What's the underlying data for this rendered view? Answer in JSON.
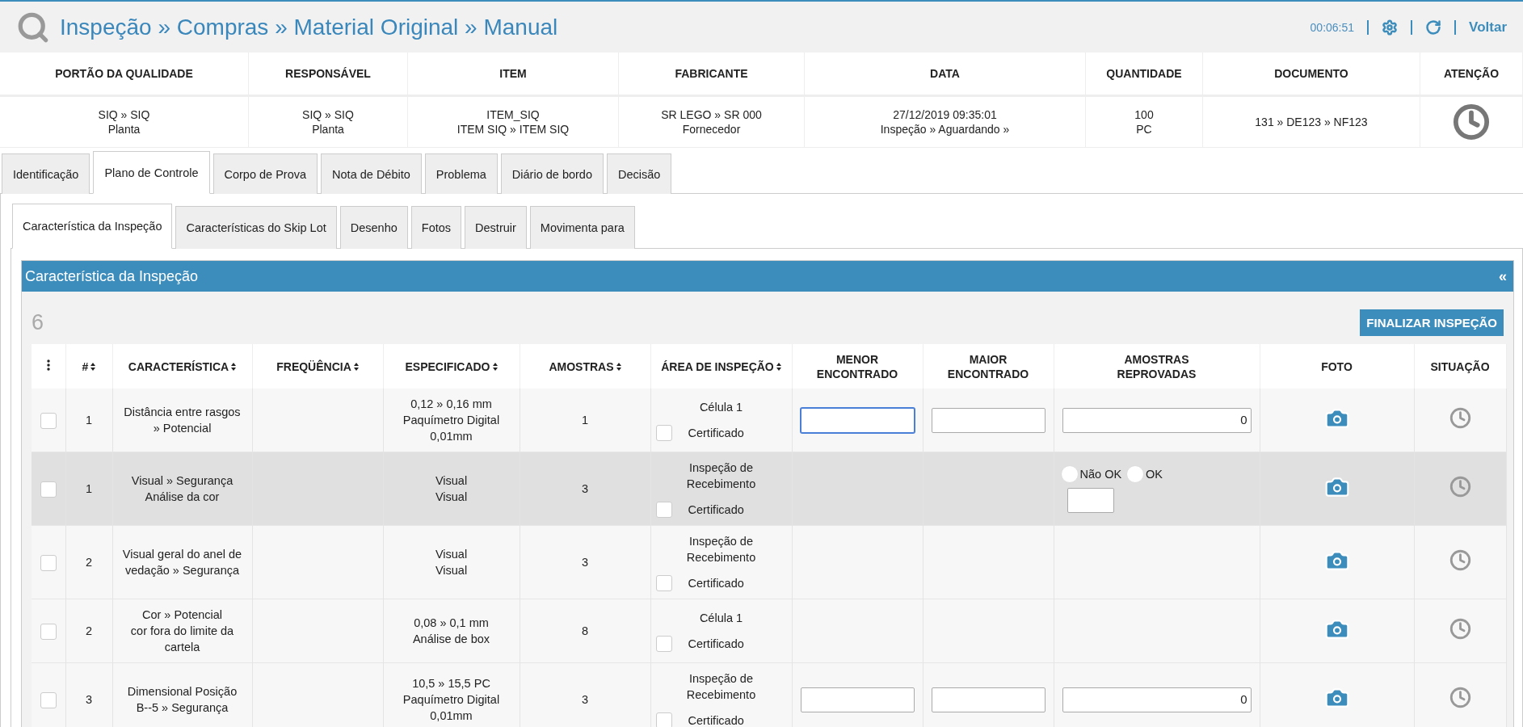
{
  "header": {
    "title": "Inspeção » Compras » Material Original » Manual",
    "timer": "00:06:51",
    "back_link": "Voltar"
  },
  "summary": {
    "columns": [
      "PORTÃO DA QUALIDADE",
      "RESPONSÁVEL",
      "ITEM",
      "FABRICANTE",
      "DATA",
      "QUANTIDADE",
      "DOCUMENTO",
      "ATENÇÃO"
    ],
    "values": [
      [
        "SIQ » SIQ",
        "Planta"
      ],
      [
        "SIQ » SIQ",
        "Planta"
      ],
      [
        "ITEM_SIQ",
        "ITEM SIQ » ITEM SIQ"
      ],
      [
        "SR LEGO » SR 000",
        "Fornecedor"
      ],
      [
        "27/12/2019 09:35:01",
        "Inspeção » Aguardando »"
      ],
      [
        "100",
        "PC"
      ],
      [
        "131 » DE123 » NF123"
      ]
    ]
  },
  "tabs": [
    {
      "label": "Identificação",
      "selected": false
    },
    {
      "label": "Plano de Controle",
      "selected": true
    },
    {
      "label": "Corpo de Prova",
      "selected": false
    },
    {
      "label": "Nota de Débito",
      "selected": false
    },
    {
      "label": "Problema",
      "selected": false
    },
    {
      "label": "Diário de bordo",
      "selected": false
    },
    {
      "label": "Decisão",
      "selected": false
    }
  ],
  "subtabs": [
    {
      "label": "Característica da Inspeção",
      "selected": true
    },
    {
      "label": "Características do Skip Lot",
      "selected": false
    },
    {
      "label": "Desenho",
      "selected": false
    },
    {
      "label": "Fotos",
      "selected": false
    },
    {
      "label": "Destruir",
      "selected": false
    },
    {
      "label": "Movimenta para",
      "selected": false
    }
  ],
  "panel": {
    "title": "Característica da Inspeção",
    "collapse_glyph": "«",
    "count": "6",
    "finish_button": "FINALIZAR INSPEÇÃO"
  },
  "table": {
    "columns": [
      {
        "kind": "menu"
      },
      {
        "kind": "text",
        "label": [
          "#"
        ],
        "sortable": true
      },
      {
        "kind": "text",
        "label": [
          "CARACTERÍSTICA"
        ],
        "sortable": true
      },
      {
        "kind": "text",
        "label": [
          "FREQÜÊNCIA"
        ],
        "sortable": true
      },
      {
        "kind": "text",
        "label": [
          "ESPECIFICADO"
        ],
        "sortable": true
      },
      {
        "kind": "text",
        "label": [
          "AMOSTRAS"
        ],
        "sortable": true
      },
      {
        "kind": "text",
        "label": [
          "ÁREA DE INSPEÇÃO"
        ],
        "sortable": true
      },
      {
        "kind": "text",
        "label": [
          "MENOR",
          "ENCONTRADO"
        ],
        "sortable": false
      },
      {
        "kind": "text",
        "label": [
          "MAIOR",
          "ENCONTRADO"
        ],
        "sortable": false
      },
      {
        "kind": "text",
        "label": [
          "AMOSTRAS",
          "REPROVADAS"
        ],
        "sortable": false
      },
      {
        "kind": "text",
        "label": [
          "FOTO"
        ],
        "sortable": false
      },
      {
        "kind": "text",
        "label": [
          "SITUAÇÃO"
        ],
        "sortable": false
      }
    ],
    "rows": [
      {
        "selected": false,
        "checked": false,
        "number": "1",
        "characteristic": [
          "Distância entre rasgos",
          "» Potencial"
        ],
        "specified": [
          "0,12 » 0,16 mm",
          "Paquímetro Digital",
          "0,01mm"
        ],
        "samples": "1",
        "area": [
          "Célula 1"
        ],
        "certificate": {
          "label": "Certificado",
          "checked": false
        },
        "measure": {
          "kind": "fields",
          "lowest_focused": true,
          "rejected": "0"
        }
      },
      {
        "selected": true,
        "checked": false,
        "number": "1",
        "characteristic": [
          "Visual » Segurança",
          "Análise da cor"
        ],
        "specified": [
          "Visual",
          "Visual"
        ],
        "samples": "3",
        "area": [
          "Inspeção de",
          "Recebimento"
        ],
        "certificate": {
          "label": "Certificado",
          "checked": false
        },
        "measure": {
          "kind": "verdict",
          "options": [
            {
              "label": "Não OK",
              "selected": false
            },
            {
              "label": "OK",
              "selected": false
            }
          ]
        }
      },
      {
        "selected": false,
        "checked": false,
        "number": "2",
        "characteristic": [
          "Visual geral do anel de",
          "vedação » Segurança"
        ],
        "specified": [
          "Visual",
          "Visual"
        ],
        "samples": "3",
        "area": [
          "Inspeção de",
          "Recebimento"
        ],
        "certificate": {
          "label": "Certificado",
          "checked": false
        },
        "measure": {
          "kind": "none"
        }
      },
      {
        "selected": false,
        "checked": false,
        "number": "2",
        "characteristic": [
          "Cor » Potencial",
          "cor fora do limite da",
          "cartela"
        ],
        "specified": [
          "0,08 » 0,1 mm",
          "Análise de box"
        ],
        "samples": "8",
        "area": [
          "Célula 1"
        ],
        "certificate": {
          "label": "Certificado",
          "checked": false
        },
        "measure": {
          "kind": "none"
        }
      },
      {
        "selected": false,
        "checked": false,
        "number": "3",
        "characteristic": [
          "Dimensional Posição",
          "B--5 » Segurança"
        ],
        "specified": [
          "10,5 » 15,5 PC",
          "Paquímetro Digital",
          "0,01mm"
        ],
        "samples": "3",
        "area": [
          "Inspeção de",
          "Recebimento"
        ],
        "certificate": {
          "label": "Certificado",
          "checked": false
        },
        "measure": {
          "kind": "fields",
          "lowest_focused": false,
          "rejected": "0"
        }
      }
    ]
  }
}
